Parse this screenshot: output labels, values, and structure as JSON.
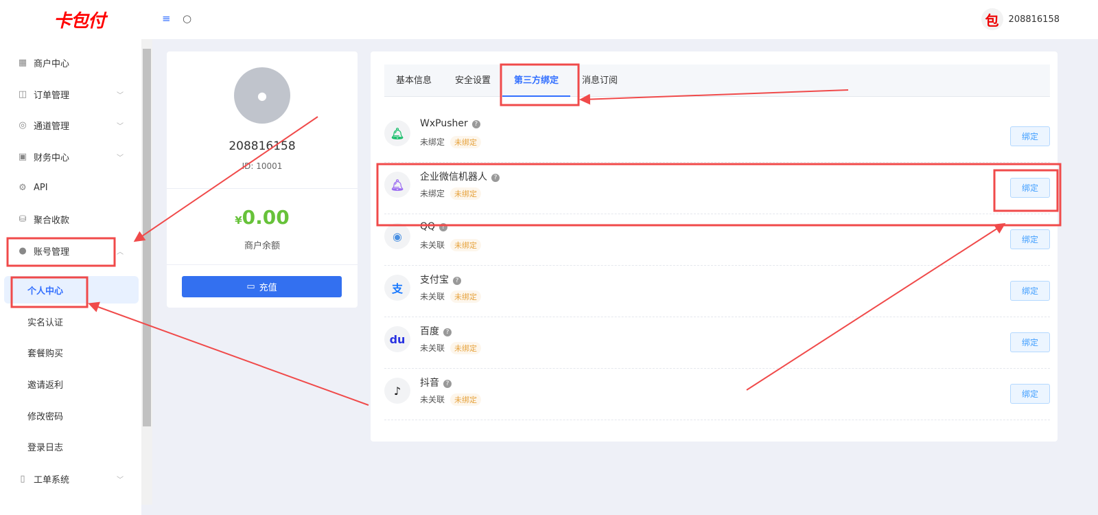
{
  "header": {
    "logo": "卡包付",
    "menu_icon": "menu-icon",
    "search_icon": "search-icon",
    "user_avatar_text": "包",
    "username": "208816158"
  },
  "sidebar": {
    "items": [
      {
        "label": "商户中心",
        "icon": "grid-icon",
        "expandable": false
      },
      {
        "label": "订单管理",
        "icon": "bag-icon",
        "expandable": true
      },
      {
        "label": "通道管理",
        "icon": "ring-icon",
        "expandable": true
      },
      {
        "label": "财务中心",
        "icon": "wallet-icon",
        "expandable": true
      },
      {
        "label": "API",
        "icon": "chip-icon",
        "expandable": false
      },
      {
        "label": "聚合收款",
        "icon": "coins-icon",
        "expandable": false
      },
      {
        "label": "账号管理",
        "icon": "user-icon",
        "expandable": true,
        "expanded": true
      },
      {
        "label": "工单系统",
        "icon": "book-icon",
        "expandable": true
      }
    ],
    "sub_items": [
      {
        "label": "个人中心",
        "active": true
      },
      {
        "label": "实名认证"
      },
      {
        "label": "套餐购买"
      },
      {
        "label": "邀请返利"
      },
      {
        "label": "修改密码"
      },
      {
        "label": "登录日志"
      }
    ]
  },
  "profile": {
    "username": "208816158",
    "id_label": "ID: 10001",
    "currency": "¥",
    "balance": "0.00",
    "balance_label": "商户余额",
    "recharge_label": "充值"
  },
  "tabs": [
    {
      "label": "基本信息"
    },
    {
      "label": "安全设置"
    },
    {
      "label": "第三方绑定",
      "active": true
    },
    {
      "label": "消息订阅"
    }
  ],
  "bindings": [
    {
      "name": "WxPusher",
      "status": "未绑定",
      "tag": "未绑定",
      "button": "绑定",
      "icon": "bell-icon",
      "color": "#19be6b"
    },
    {
      "name": "企业微信机器人",
      "status": "未绑定",
      "tag": "未绑定",
      "button": "绑定",
      "icon": "bell-icon",
      "color": "#9b6bf2"
    },
    {
      "name": "QQ",
      "status": "未关联",
      "tag": "未绑定",
      "button": "绑定",
      "icon": "qq-icon",
      "color": "#4a90e2"
    },
    {
      "name": "支付宝",
      "status": "未关联",
      "tag": "未绑定",
      "button": "绑定",
      "icon": "alipay-icon",
      "color": "#1677ff"
    },
    {
      "name": "百度",
      "status": "未关联",
      "tag": "未绑定",
      "button": "绑定",
      "icon": "baidu-icon",
      "color": "#2932e1"
    },
    {
      "name": "抖音",
      "status": "未关联",
      "tag": "未绑定",
      "button": "绑定",
      "icon": "tiktok-icon",
      "color": "#111111"
    }
  ],
  "colors": {
    "accent": "#3370ff",
    "annotation": "#f04a4a",
    "balance": "#67c23a",
    "tag": "#e6a23c"
  }
}
